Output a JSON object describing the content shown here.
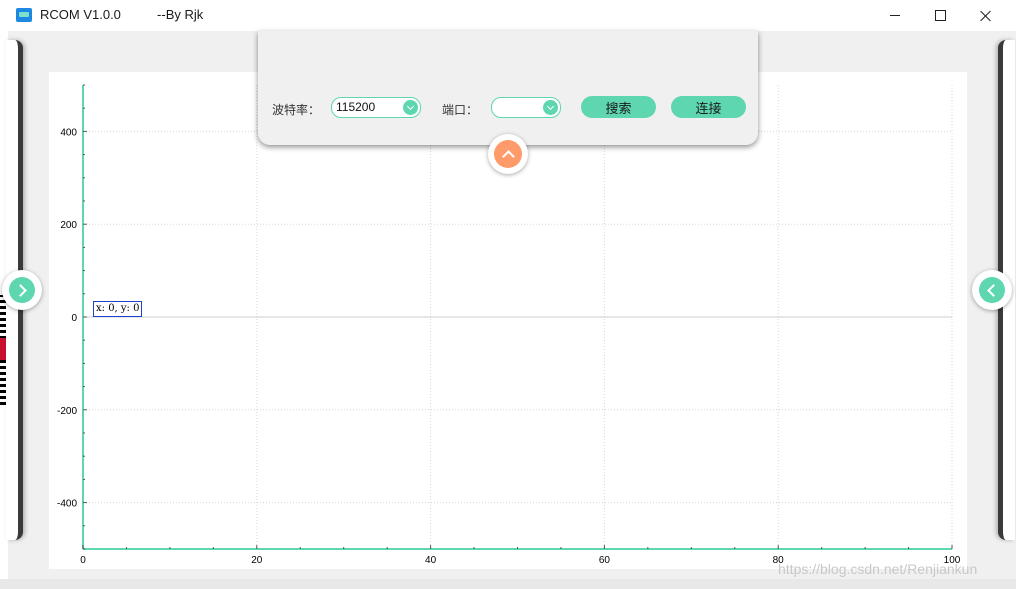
{
  "window": {
    "title": "RCOM V1.0.0          --By Rjk"
  },
  "top_panel": {
    "baud_label": "波特率：",
    "baud_value": "115200",
    "port_label": "端口：",
    "port_value": "",
    "search_button": "搜索",
    "connect_button": "连接"
  },
  "chart": {
    "coord_readout": "x: 0, y: 0"
  },
  "chart_data": {
    "type": "line",
    "xlim": [
      0,
      100
    ],
    "ylim": [
      -500,
      500
    ],
    "x_ticks": [
      "0",
      "20",
      "40",
      "60",
      "80",
      "100"
    ],
    "y_ticks": [
      "400",
      "200",
      "0",
      "-200",
      "-400"
    ],
    "grid": true,
    "series": []
  },
  "watermark": "https://blog.csdn.net/Renjiankun",
  "colors": {
    "accent": "#5ed6b0",
    "collapse": "#ff9a6a"
  }
}
